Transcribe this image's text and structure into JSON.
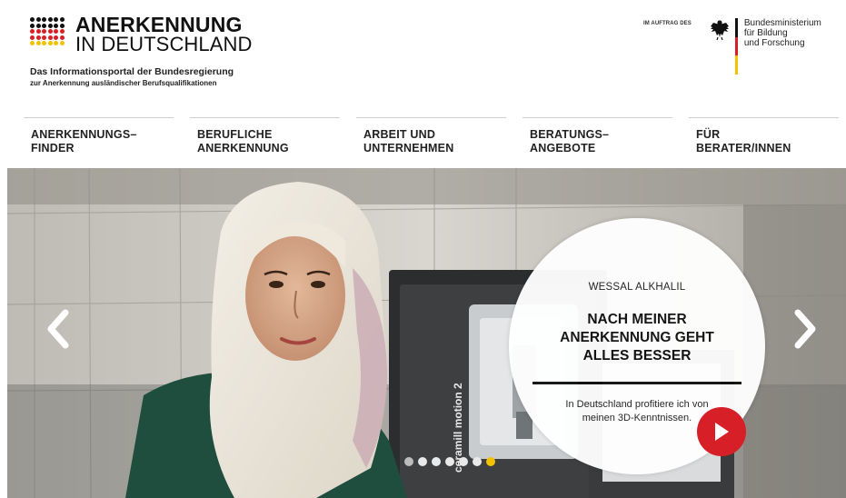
{
  "brand": {
    "logo_line1": "ANERKENNUNG",
    "logo_line2": "IN DEUTSCHLAND",
    "tagline_1": "Das Informationsportal der Bundesregierung",
    "tagline_2": "zur Anerkennung ausländischer Berufsqualifikationen",
    "logo_colors": [
      "#111111",
      "#d61f27",
      "#f2c100"
    ]
  },
  "ministry": {
    "auftrag_label": "IM AUFTRAG DES",
    "name_line1": "Bundesministerium",
    "name_line2": "für Bildung",
    "name_line3": "und Forschung",
    "icon": "federal-eagle-icon",
    "flag_colors": [
      "#111111",
      "#d61f27",
      "#f2c100"
    ]
  },
  "nav": {
    "items": [
      {
        "label": "ANERKENNUNGS–\nFINDER"
      },
      {
        "label": "BERUFLICHE\nANERKENNUNG"
      },
      {
        "label": "ARBEIT UND\nUNTERNEHMEN"
      },
      {
        "label": "BERATUNGS–\nANGEBOTE"
      },
      {
        "label": "FÜR\nBERATER/INNEN"
      }
    ]
  },
  "hero": {
    "name": "WESSAL ALKHALIL",
    "headline": "NACH MEINER\nANERKENNUNG GEHT\nALLES BESSER",
    "text": "In Deutschland profitiere ich von\nmeinen 3D-Kenntnissen.",
    "machine_label": "ceramill motion 2",
    "prev_icon": "chevron-left-icon",
    "next_icon": "chevron-right-icon",
    "play_icon": "play-icon",
    "accent_color": "#d61f27",
    "slide_count": 7,
    "active_slide": 7
  }
}
